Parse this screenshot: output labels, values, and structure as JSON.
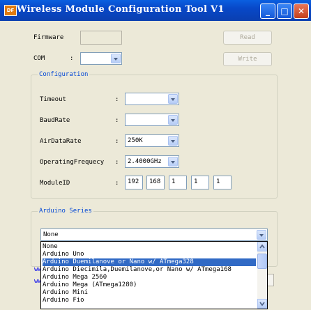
{
  "window": {
    "title": "Wireless Module Configuration Tool V1",
    "icon_text": "DF",
    "minimize_label": "_",
    "maximize_label": "□",
    "close_label": "✕"
  },
  "top": {
    "firmware_label": "Firmware",
    "firmware_value": "",
    "com_label": "COM",
    "com_value": "",
    "colon": ":",
    "read_button": "Read",
    "write_button": "Write"
  },
  "configuration": {
    "legend": "Configuration",
    "timeout_label": "Timeout",
    "timeout_value": "",
    "baudrate_label": "BaudRate",
    "baudrate_value": "",
    "airdatarate_label": "AirDataRate",
    "airdatarate_value": "250K",
    "freq_label": "OperatingFrequecy",
    "freq_value": "2.4000GHz",
    "moduleid_label": "ModuleID",
    "moduleid_values": [
      "192",
      "168",
      "1",
      "1",
      "1"
    ],
    "colon": ":"
  },
  "arduino": {
    "legend": "Arduino Series",
    "selected_value": "None",
    "options": [
      "None",
      "Arduino Uno",
      "Arduino Duemilanove or Nano w/ ATmega328",
      "Arduino Diecimila,Duemilanove,or Nano w/ ATmega168",
      "Arduino Mega 2560",
      "Arduino Mega (ATmega1280)",
      "Arduino Mini",
      "Arduino Fio"
    ],
    "highlighted_index": 2,
    "hidden_link_fragment_1": "ww",
    "hidden_link_fragment_2": "ww"
  },
  "colors": {
    "titlebar": "#0a5fe0",
    "window_bg": "#ece9d8",
    "legend_text": "#0046d5",
    "selection": "#316ac5"
  }
}
